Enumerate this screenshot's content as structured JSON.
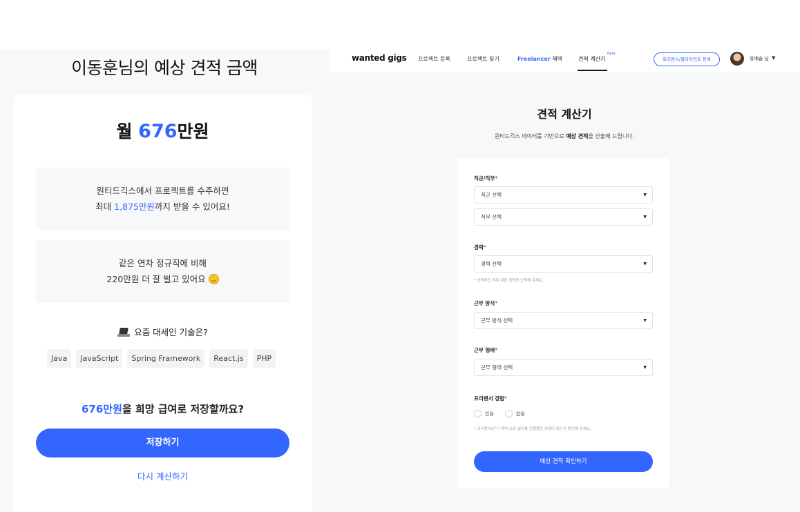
{
  "left": {
    "title": "이동훈님의 예상 견적 금액",
    "monthly_prefix": "월 ",
    "monthly_amount": "676",
    "monthly_suffix": "만원",
    "info1_line1": "원티드긱스에서 프로젝트를 수주하면",
    "info1_line2_prefix": "최대 ",
    "info1_line2_amount": "1,875만원",
    "info1_line2_suffix": "까지 받을 수 있어요!",
    "info2_line1": "같은 연차 정규직에 비해",
    "info2_line2": "220만원 더 잘 벌고 있어요",
    "info2_emoji": "smile-emoji",
    "skills_title": "요즘 대세인 기술은?",
    "skills_icon": "laptop-icon",
    "skills": [
      "Java",
      "JavaScript",
      "Spring Framework",
      "React.js",
      "PHP"
    ],
    "save_question_amount": "676만원",
    "save_question_suffix": "을 희망 급여로 저장할까요?",
    "save_button": "저장하기",
    "recalc_link": "다시 계산하기"
  },
  "nav": {
    "logo": "wanted gigs",
    "items": [
      "프로젝트 등록",
      "프로젝트 찾기"
    ],
    "freelancer_blue": "Freelancer",
    "freelancer_suffix": " 혜택",
    "active_item": "견적 계산기",
    "beta": "Beta",
    "register_button": "프리랜서/클라이언트 등록",
    "user_name": "유예솔 님",
    "user_caret": "▼"
  },
  "calculator": {
    "title": "견적 계산기",
    "subtitle_prefix": "원티드긱스 데이터를 기반으로 ",
    "subtitle_bold": "예상 견적",
    "subtitle_suffix": "을 산출해 드립니다.",
    "job_label": "직군/직무",
    "job_group_placeholder": "직군 선택",
    "job_role_placeholder": "직무 선택",
    "career_label": "경력",
    "career_placeholder": "경력 선택",
    "career_hint": "* 선택하신 직무 관련 경력만 입력해 주세요.",
    "work_method_label": "근무 방식",
    "work_method_placeholder": "근무 방식 선택",
    "work_type_label": "근무 형태",
    "work_type_placeholder": "근무 형태 선택",
    "freelance_label": "프리랜서 경험",
    "radio_yes": "있음",
    "radio_no": "없음",
    "freelance_hint": "* 프리랜서(단기 계약)으로 업무를 진행했던 경험이 있는지 확인해 주세요.",
    "required_mark": "*",
    "select_caret": "▼",
    "submit_button": "예상 견적 확인하기"
  },
  "colors": {
    "accent": "#3366ff",
    "required": "#e5484d",
    "panel_bg": "#f7f8fa"
  }
}
